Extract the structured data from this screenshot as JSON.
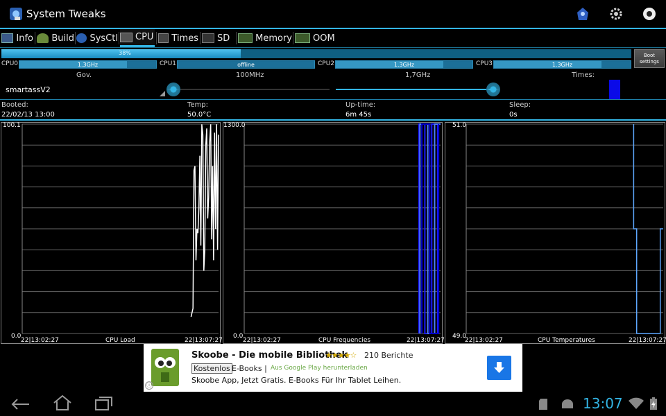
{
  "app": {
    "title": "System Tweaks"
  },
  "tabs": [
    {
      "label": "Info"
    },
    {
      "label": "Build"
    },
    {
      "label": "SysCtl"
    },
    {
      "label": "CPU"
    },
    {
      "label": "Times"
    },
    {
      "label": "SD"
    },
    {
      "label": "Memory"
    },
    {
      "label": "OOM"
    }
  ],
  "cpu_load": {
    "percent_label": "38%",
    "fraction": 0.38
  },
  "cpus": [
    {
      "name": "CPU0",
      "value": "1.3GHz"
    },
    {
      "name": "CPU1",
      "value": "offline"
    },
    {
      "name": "CPU2",
      "value": "1.3GHz"
    },
    {
      "name": "CPU3",
      "value": "1.3GHz"
    }
  ],
  "boot_settings": {
    "line1": "Boot",
    "line2": "settings"
  },
  "governor": {
    "gov_label": "Gov.",
    "gov_value": "smartassV2",
    "min_label": "100MHz",
    "max_label": "1,7GHz",
    "times_label": "Times:",
    "min_fraction": 0.0,
    "max_fraction": 1.0
  },
  "info": {
    "booted_label": "Booted:",
    "booted_value": "22/02/13 13:00",
    "temp_label": "Temp:",
    "temp_value": "50.0°C",
    "uptime_label": "Up-time:",
    "uptime_value": "6m 45s",
    "sleep_label": "Sleep:",
    "sleep_value": "0s"
  },
  "chart_data": [
    {
      "type": "line",
      "title": "CPU Load",
      "ylim": [
        0.0,
        100.1
      ],
      "y_top_label": "100.1",
      "y_bottom_label": "0.0",
      "x_start_label": "22|13:02:27",
      "x_end_label": "22|13:07:27",
      "color": "#ffffff",
      "x": [
        0.86,
        0.87,
        0.875,
        0.88,
        0.885,
        0.89,
        0.895,
        0.9,
        0.905,
        0.91,
        0.915,
        0.92,
        0.925,
        0.93,
        0.935,
        0.94,
        0.945,
        0.95,
        0.955,
        0.96,
        0.965,
        0.97,
        0.975,
        0.98,
        0.985,
        0.99,
        0.995,
        1.0
      ],
      "values": [
        8,
        12,
        78,
        80,
        35,
        50,
        48,
        60,
        85,
        42,
        100,
        95,
        30,
        40,
        90,
        98,
        55,
        65,
        92,
        100,
        45,
        80,
        35,
        96,
        50,
        100,
        40,
        95
      ]
    },
    {
      "type": "line",
      "title": "CPU Frequencies",
      "ylim": [
        0.0,
        1300.0
      ],
      "y_top_label": "1300.0",
      "y_bottom_label": "0.0",
      "x_start_label": "22|13:02:27",
      "x_end_label": "22|13:07:27",
      "series": [
        {
          "color": "#1a1aff",
          "x": [
            0.89,
            0.89,
            0.92,
            0.92,
            0.955,
            0.955,
            0.985,
            0.985
          ],
          "values": [
            0,
            1300,
            1300,
            0,
            0,
            1300,
            1300,
            0
          ]
        },
        {
          "color": "#4f7bff",
          "x": [
            0.895,
            0.895,
            0.935,
            0.935,
            0.97,
            0.97,
            1.0
          ],
          "values": [
            0,
            1300,
            1300,
            0,
            0,
            1300,
            1300
          ]
        },
        {
          "color": "#0000cc",
          "x": [
            0.905,
            0.905,
            0.945,
            0.945,
            0.99,
            0.99
          ],
          "values": [
            0,
            1300,
            1300,
            0,
            0,
            1300
          ]
        }
      ]
    },
    {
      "type": "line",
      "title": "CPU Temperatures",
      "ylim": [
        49.0,
        51.0
      ],
      "y_top_label": "51.0",
      "y_bottom_label": "49.0",
      "x_start_label": "22|13:02:27",
      "x_end_label": "22|13:07:27",
      "color": "#5ea8ff",
      "x": [
        0.85,
        0.85,
        0.865,
        0.865,
        0.985,
        0.985,
        1.0
      ],
      "values": [
        51.0,
        50.0,
        50.0,
        49.0,
        49.0,
        50.0,
        50.0
      ]
    }
  ],
  "ad": {
    "title": "Skoobe - Die mobile Bibliothek",
    "stars": "★★★★☆",
    "reviews": "210 Berichte",
    "price": "Kostenlos",
    "category": "E-Books |",
    "source": "Aus Google Play herunterladen",
    "description": "Skoobe App, Jetzt Gratis. E-Books Für Ihr Tablet Leihen.",
    "info": "ⓘ"
  },
  "status": {
    "time": "13:07"
  },
  "colors": {
    "accent": "#33b5e5",
    "background": "#000000"
  }
}
